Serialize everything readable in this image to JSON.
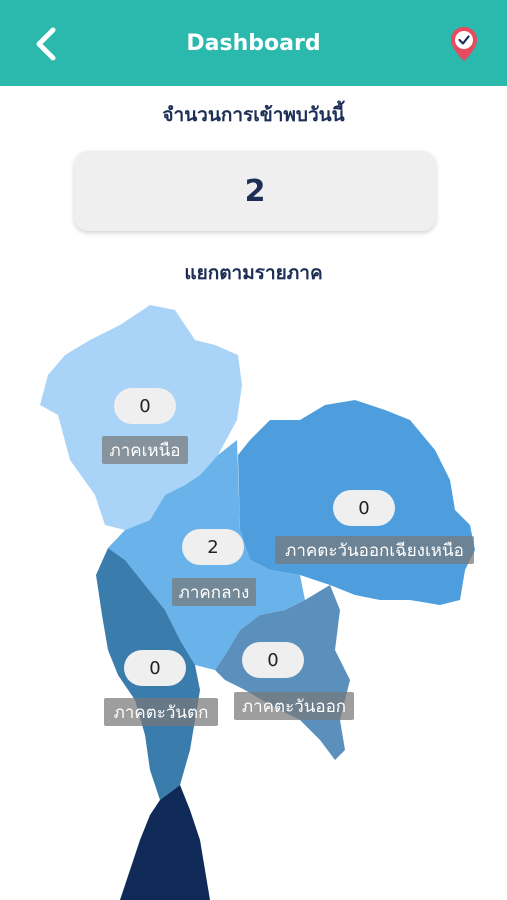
{
  "header": {
    "title": "Dashboard",
    "back_icon": "chevron-left-icon",
    "location_icon": "map-pin-check-icon"
  },
  "summary": {
    "label": "จำนวนการเข้าพบวันนี้",
    "count": "2"
  },
  "regions": {
    "label": "แยกตามรายภาค",
    "north": {
      "name": "ภาคเหนือ",
      "count": "0",
      "color": "#a9d4f7"
    },
    "central": {
      "name": "ภาคกลาง",
      "count": "2",
      "color": "#6ab3ea"
    },
    "northeast": {
      "name": "ภาคตะวันออกเฉียงเหนือ",
      "count": "0",
      "color": "#4e9edd"
    },
    "west": {
      "name": "ภาคตะวันตก",
      "count": "0",
      "color": "#3a7cac"
    },
    "east": {
      "name": "ภาคตะวันออก",
      "count": "0",
      "color": "#5b90bd"
    },
    "south": {
      "color": "#0f2a57"
    }
  },
  "colors": {
    "header": "#2bb9ad",
    "text_dark": "#1d2f57",
    "pin": "#e84a5f"
  }
}
